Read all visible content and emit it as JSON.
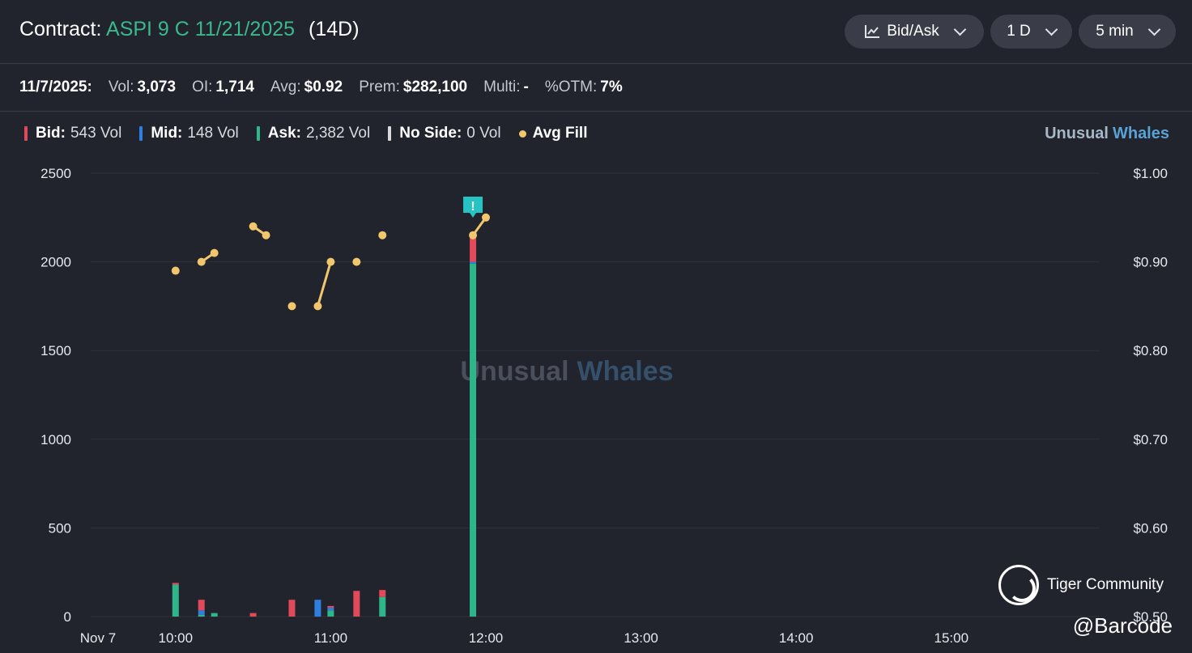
{
  "header": {
    "contract_label": "Contract:",
    "contract_ticker": "ASPI 9 C 11/21/2025",
    "contract_dte": "(14D)",
    "chart_type_button": "Bid/Ask",
    "range_button": "1 D",
    "interval_button": "5 min"
  },
  "info": {
    "date": "11/7/2025:",
    "vol_label": "Vol:",
    "vol_value": "3,073",
    "oi_label": "OI:",
    "oi_value": "1,714",
    "avg_label": "Avg:",
    "avg_value": "$0.92",
    "prem_label": "Prem:",
    "prem_value": "$282,100",
    "multi_label": "Multi:",
    "multi_value": "-",
    "otm_label": "%OTM:",
    "otm_value": "7%"
  },
  "legend": {
    "bid_label": "Bid:",
    "bid_value": "543 Vol",
    "mid_label": "Mid:",
    "mid_value": "148 Vol",
    "ask_label": "Ask:",
    "ask_value": "2,382 Vol",
    "noside_label": "No Side:",
    "noside_value": "0 Vol",
    "avgfill_label": "Avg Fill"
  },
  "brand": {
    "part1": "Unusual",
    "part2": "Whales"
  },
  "overlay": {
    "tiger_text": "Tiger Community",
    "watermark": "@Barcode",
    "alert_glyph": "!"
  },
  "colors": {
    "bid": "#e04a5a",
    "mid": "#2f7fe0",
    "ask": "#2fb58a",
    "noside": "#d9d9d9",
    "avg_fill": "#f2c66d",
    "grid": "#2e313c",
    "alert": "#27c2c2"
  },
  "chart_data": {
    "type": "bar",
    "title": "",
    "x_tick_labels": [
      "Nov 7",
      "10:00",
      "11:00",
      "12:00",
      "13:00",
      "14:00",
      "15:00"
    ],
    "y_left": {
      "ticks": [
        "0",
        "500",
        "1000",
        "1500",
        "2000",
        "2500"
      ],
      "ylim": [
        0,
        2500
      ]
    },
    "y_right": {
      "ticks": [
        "$0.50",
        "$0.60",
        "$0.70",
        "$0.80",
        "$0.90",
        "$1.00"
      ],
      "ylim": [
        0.5,
        1.0
      ]
    },
    "grid": true,
    "watermark_text": {
      "part1": "Unusual",
      "part2": "Whales"
    },
    "bars": [
      {
        "time": "10:00",
        "ask": 180,
        "mid": 0,
        "bid": 10
      },
      {
        "time": "10:10",
        "ask": 10,
        "mid": 25,
        "bid": 60
      },
      {
        "time": "10:15",
        "ask": 20,
        "mid": 0,
        "bid": 0
      },
      {
        "time": "10:30",
        "ask": 0,
        "mid": 0,
        "bid": 20
      },
      {
        "time": "10:45",
        "ask": 0,
        "mid": 0,
        "bid": 95
      },
      {
        "time": "10:55",
        "ask": 0,
        "mid": 95,
        "bid": 0
      },
      {
        "time": "11:00",
        "ask": 35,
        "mid": 15,
        "bid": 10
      },
      {
        "time": "11:10",
        "ask": 0,
        "mid": 0,
        "bid": 145
      },
      {
        "time": "11:20",
        "ask": 110,
        "mid": 0,
        "bid": 40
      },
      {
        "time": "11:55",
        "ask": 1990,
        "mid": 10,
        "bid": 145
      }
    ],
    "avg_fill_segments": [
      [
        [
          "10:00",
          0.89
        ]
      ],
      [
        [
          "10:10",
          0.9
        ],
        [
          "10:15",
          0.91
        ]
      ],
      [
        [
          "10:30",
          0.94
        ],
        [
          "10:35",
          0.93
        ]
      ],
      [
        [
          "10:45",
          0.85
        ]
      ],
      [
        [
          "10:55",
          0.85
        ],
        [
          "11:00",
          0.9
        ]
      ],
      [
        [
          "11:10",
          0.9
        ]
      ],
      [
        [
          "11:20",
          0.93
        ]
      ],
      [
        [
          "11:55",
          0.93
        ],
        [
          "12:00",
          0.95
        ]
      ]
    ],
    "alert_marker_time": "11:55"
  }
}
